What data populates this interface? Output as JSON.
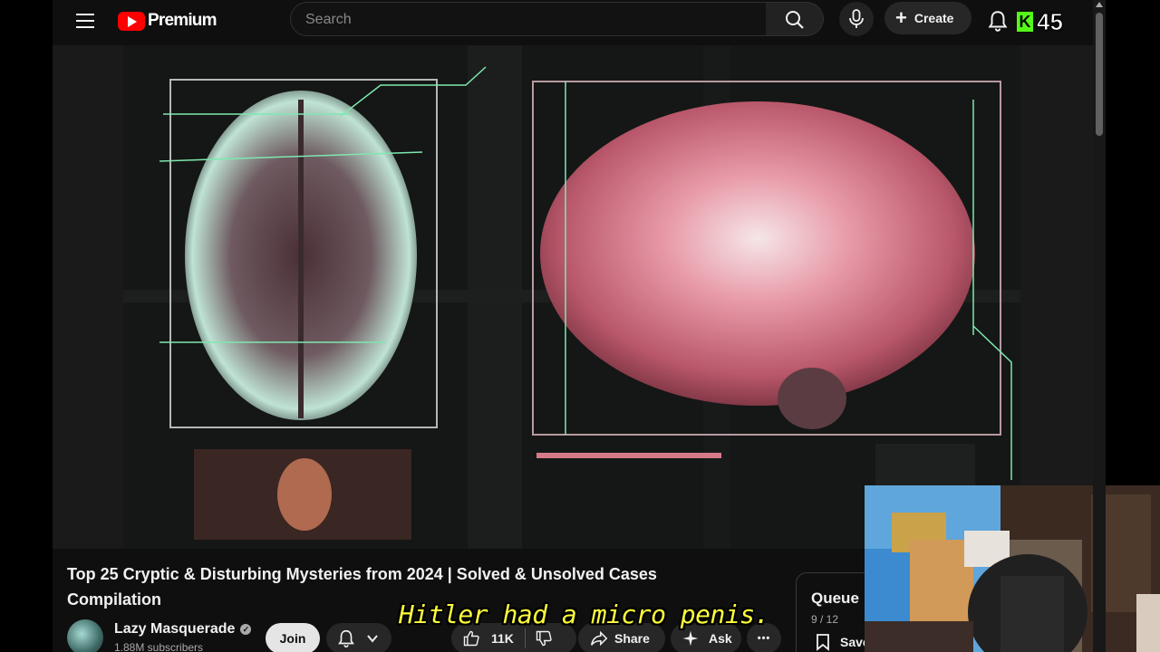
{
  "header": {
    "logo_text": "Premium",
    "search_placeholder": "Search",
    "create_label": "Create"
  },
  "overlay": {
    "kick_letter": "K",
    "viewer_count": "45"
  },
  "video": {
    "title": "Top 25 Cryptic & Disturbing Mysteries from 2024 | Solved & Unsolved Cases Compilation",
    "caption": "Hitler had a micro penis."
  },
  "channel": {
    "name": "Lazy Masquerade",
    "verified_glyph": "✓",
    "subscribers": "1.88M subscribers",
    "join_label": "Join"
  },
  "actions": {
    "like_count": "11K",
    "share_label": "Share",
    "ask_label": "Ask",
    "more_glyph": "•••"
  },
  "queue": {
    "title": "Queue",
    "count": "9 / 12",
    "save_label": "Save"
  },
  "colors": {
    "brand_red": "#ff0000",
    "kick_green": "#53fc18",
    "caption_yellow": "#ffff3c",
    "hologram_green": "#7ee8b0",
    "brain_pink": "#e37f95"
  },
  "icons": {
    "menu": "hamburger-icon",
    "search": "search-icon",
    "mic": "mic-icon",
    "bell": "bell-icon",
    "like": "thumbs-up-icon",
    "dislike": "thumbs-down-icon",
    "share": "share-arrow-icon",
    "ask": "sparkle-icon",
    "save": "bookmark-icon"
  }
}
